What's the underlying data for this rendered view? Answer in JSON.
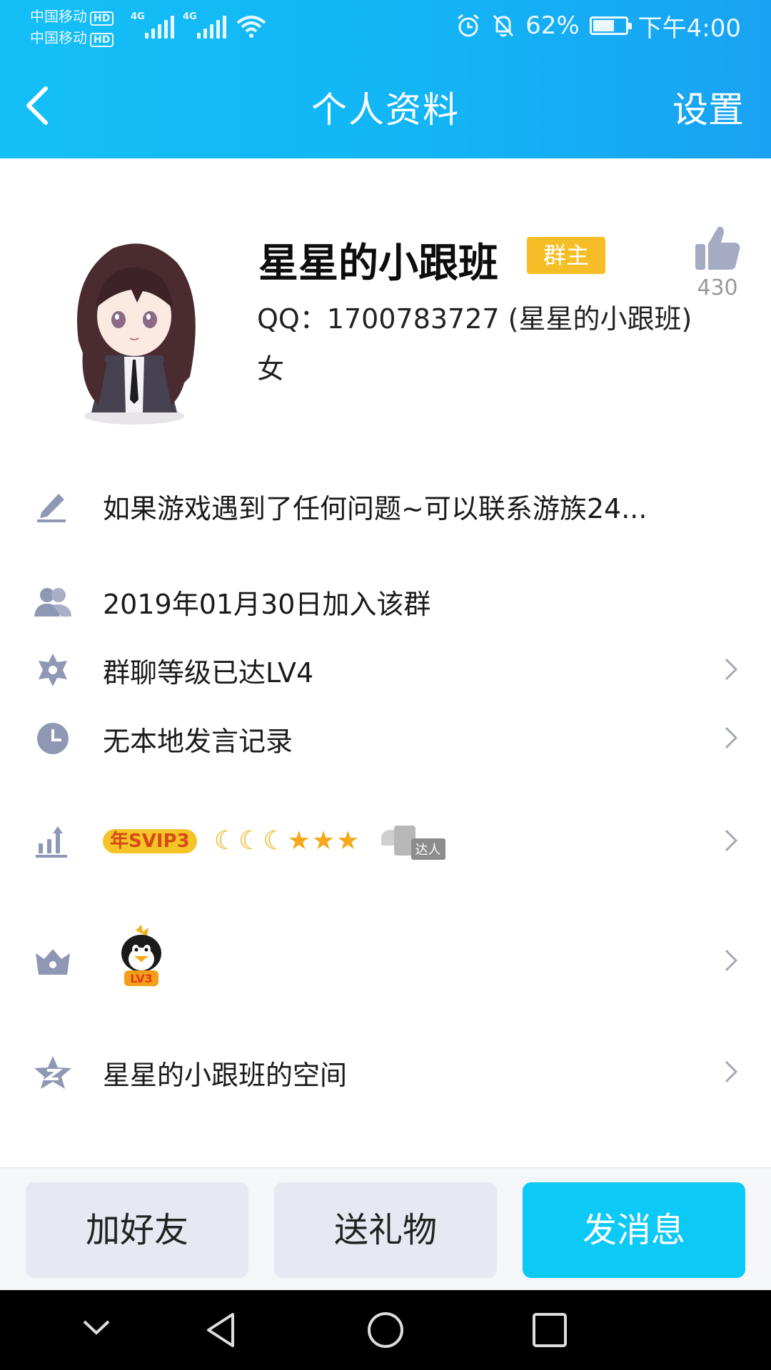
{
  "status_bar": {
    "carrier_1": "中国移动",
    "carrier_2": "中国移动",
    "hd_label": "HD",
    "network_1": "4G",
    "network_2": "4G",
    "battery": "62%",
    "time": "下午4:00"
  },
  "nav": {
    "title": "个人资料",
    "settings_label": "设置"
  },
  "profile": {
    "name": "星星的小跟班",
    "role_badge": "群主",
    "like_count": "430",
    "qq_line": "QQ：1700783727 (星星的小跟班)",
    "gender": "女"
  },
  "rows": {
    "signature": "如果游戏遇到了任何问题~可以联系游族24...",
    "join_date": "2019年01月30日加入该群",
    "group_level": "群聊等级已达LV4",
    "speech_record": "无本地发言记录",
    "vip_badge": "年SVIP3",
    "daren_label": "达人",
    "penguin_level": "LV3",
    "qzone": "星星的小跟班的空间"
  },
  "actions": {
    "add_friend": "加好友",
    "send_gift": "送礼物",
    "send_message": "发消息"
  },
  "colors": {
    "header": "#14bff6",
    "badge": "#f5be26",
    "primary_button": "#0ccaf5",
    "icon_gray": "#8e97b3"
  }
}
